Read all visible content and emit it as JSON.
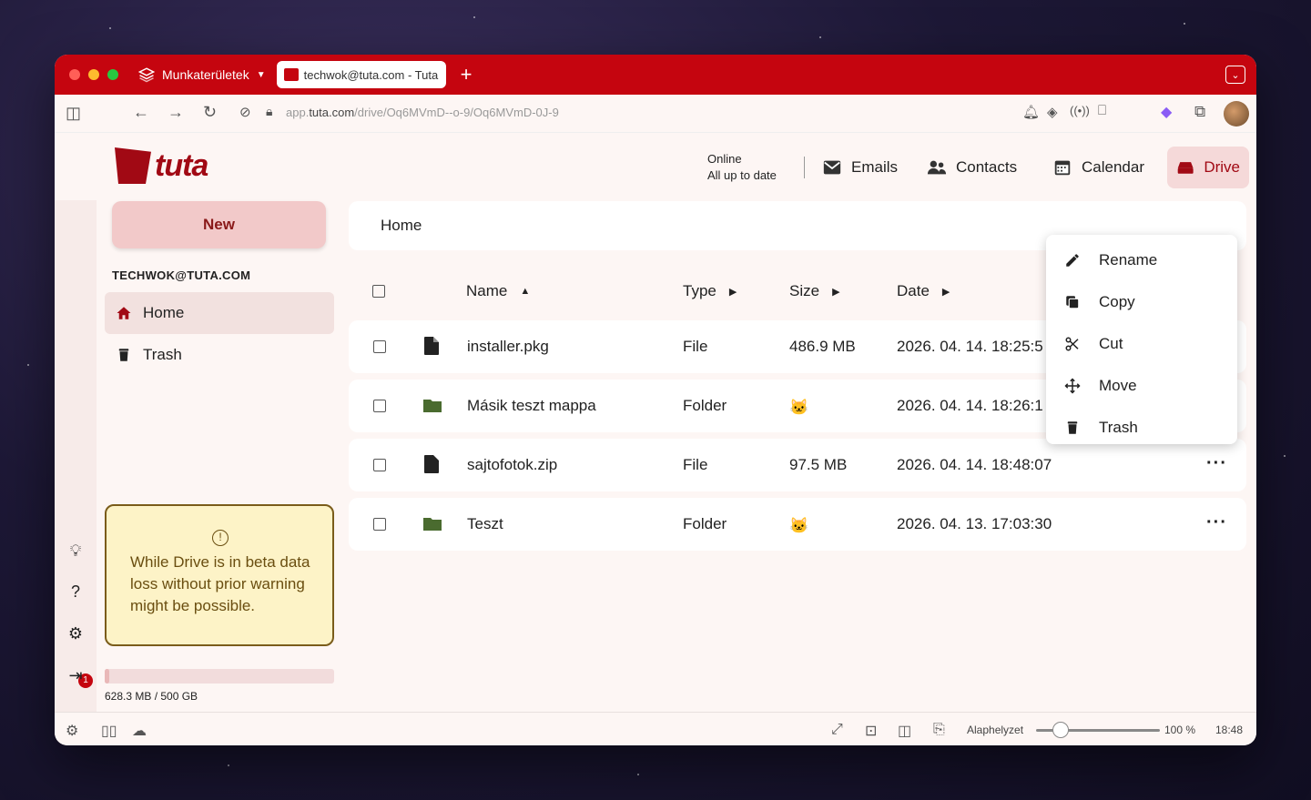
{
  "browser": {
    "workspace_label": "Munkaterületek",
    "tab_title": "techwok@tuta.com - Tuta",
    "url_prefix": "app.",
    "url_domain": "tuta.com",
    "url_path": "/drive/Oq6MVmD--o-9/Oq6MVmD-0J-9"
  },
  "app": {
    "logo_text": "tuta",
    "status_line1": "Online",
    "status_line2": "All up to date",
    "nav": [
      {
        "label": "Emails",
        "icon": "mail-icon"
      },
      {
        "label": "Contacts",
        "icon": "contacts-icon"
      },
      {
        "label": "Calendar",
        "icon": "calendar-icon"
      },
      {
        "label": "Drive",
        "icon": "drive-icon",
        "active": true
      }
    ]
  },
  "sidebar": {
    "new_label": "New",
    "account": "TECHWOK@TUTA.COM",
    "items": [
      {
        "label": "Home",
        "active": true
      },
      {
        "label": "Trash"
      }
    ],
    "beta_notice": "While Drive is in beta data loss without prior warning might be possible.",
    "storage_text": "628.3 MB / 500 GB",
    "storage_fraction": 0.0013,
    "notification_count": "1"
  },
  "main": {
    "breadcrumb": "Home",
    "columns": {
      "name": "Name",
      "type": "Type",
      "size": "Size",
      "date": "Date"
    },
    "rows": [
      {
        "name": "installer.pkg",
        "type": "File",
        "size": "486.9 MB",
        "date": "2026. 04. 14. 18:25:5",
        "kind": "file"
      },
      {
        "name": "Másik teszt mappa",
        "type": "Folder",
        "size": "🐱",
        "date": "2026. 04. 14. 18:26:1",
        "kind": "folder"
      },
      {
        "name": "sajtofotok.zip",
        "type": "File",
        "size": "97.5 MB",
        "date": "2026. 04. 14. 18:48:07",
        "kind": "file"
      },
      {
        "name": "Teszt",
        "type": "Folder",
        "size": "🐱",
        "date": "2026. 04. 13. 17:03:30",
        "kind": "folder"
      }
    ]
  },
  "context_menu": {
    "items": [
      "Rename",
      "Copy",
      "Cut",
      "Move",
      "Trash"
    ]
  },
  "statusbar": {
    "zoom_reset": "Alaphelyzet",
    "zoom_value": "100 %",
    "zoom_fraction": 0.2,
    "time": "18:48"
  },
  "colors": {
    "brand": "#c5050f",
    "brand_dark": "#a10914",
    "folder": "#4a6b2f"
  }
}
